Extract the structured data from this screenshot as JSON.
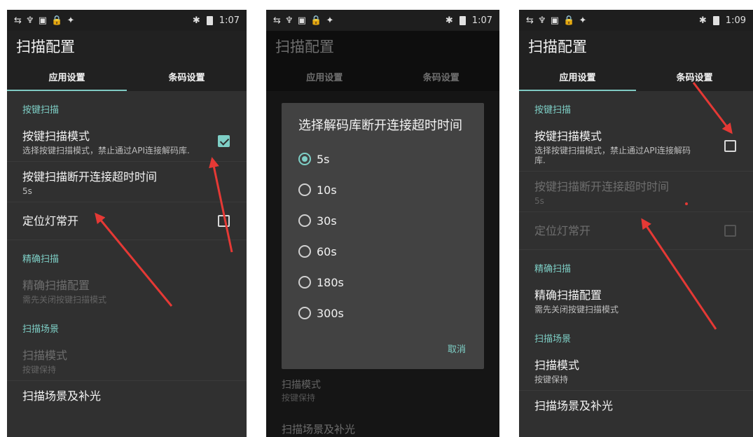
{
  "status_time": [
    "1:07",
    "1:07",
    "1:09"
  ],
  "status_icons": "⇆ ♆ ▣ 🔒 ✦",
  "bluetooth_glyph": "✱",
  "app_title": "扫描配置",
  "tabs": [
    "应用设置",
    "条码设置"
  ],
  "cat_key_scan": "按键扫描",
  "pref_mode_title": "按键扫描模式",
  "pref_mode_summary": "选择按键扫描模式，禁止通过API连接解码库.",
  "pref_timeout_title": "按键扫描断开连接超时时间",
  "pref_timeout_value": "5s",
  "pref_light_title": "定位灯常开",
  "cat_precise": "精确扫描",
  "pref_precise_title": "精确扫描配置",
  "pref_precise_summary": "需先关闭按键扫描模式",
  "cat_scene": "扫描场景",
  "pref_scanmode_title": "扫描模式",
  "pref_scanmode_value": "按键保持",
  "pref_scene_light_title": "扫描场景及补光",
  "dialog": {
    "title": "选择解码库断开连接超时时间",
    "options": [
      "5s",
      "10s",
      "30s",
      "60s",
      "180s",
      "300s"
    ],
    "selected": "5s",
    "cancel": "取消"
  },
  "colors": {
    "accent": "#7ecfc6",
    "background": "#303030",
    "arrow": "#e53935"
  }
}
